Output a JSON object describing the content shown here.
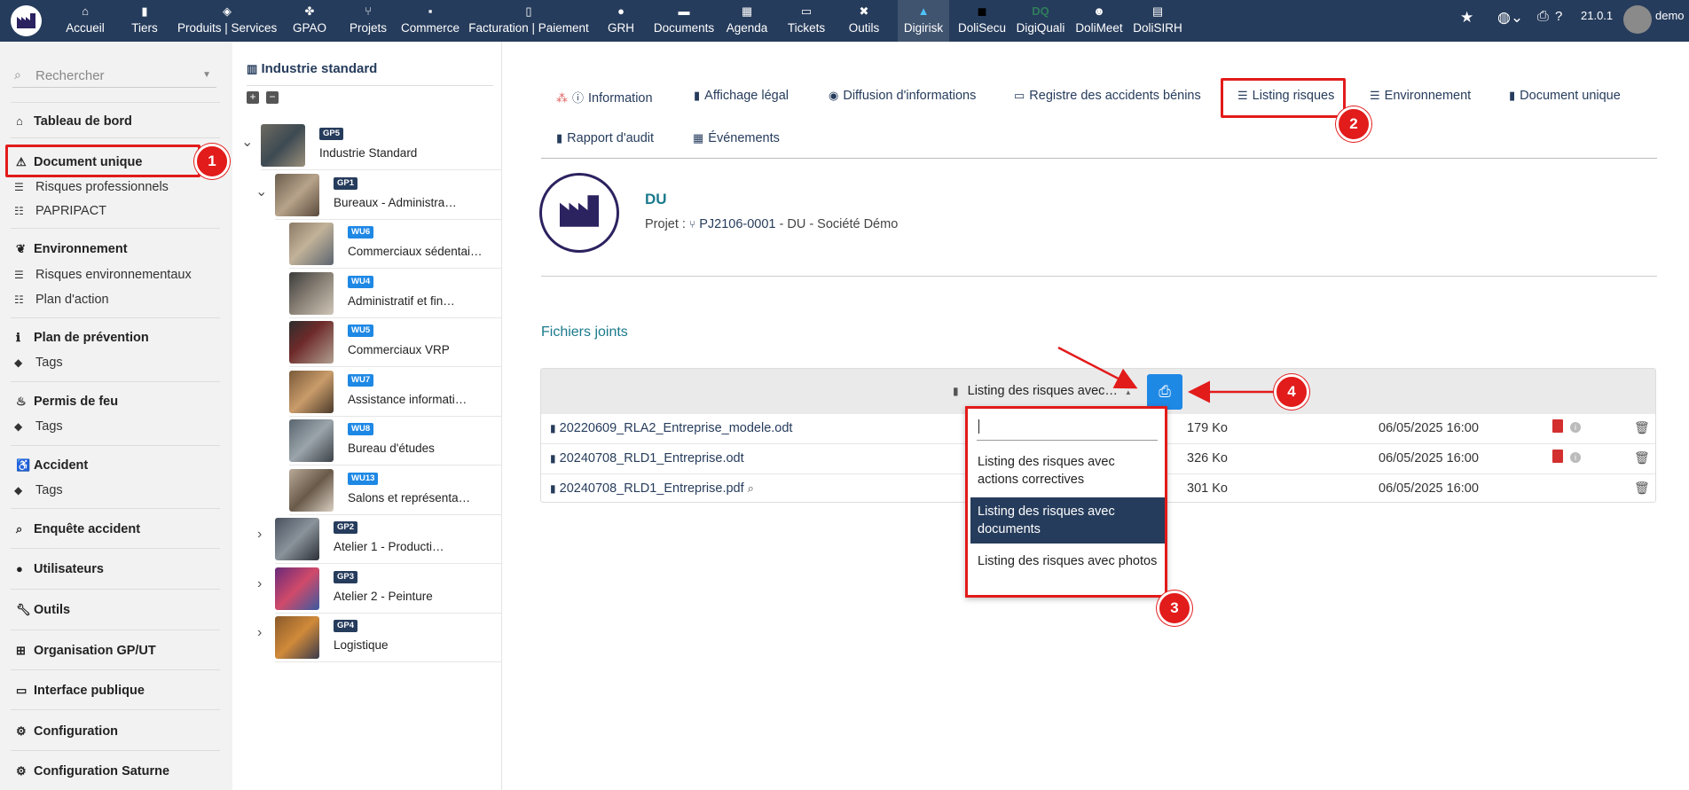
{
  "topbar": {
    "items": [
      {
        "label": "Accueil",
        "icon": "home-icon",
        "glyph": "⌂"
      },
      {
        "label": "Tiers",
        "icon": "building-icon",
        "glyph": "▮"
      },
      {
        "label": "Produits | Services",
        "icon": "cube-icon",
        "glyph": "◈"
      },
      {
        "label": "GPAO",
        "icon": "cubes-icon",
        "glyph": "✤"
      },
      {
        "label": "Projets",
        "icon": "project-icon",
        "glyph": "⑂"
      },
      {
        "label": "Commerce",
        "icon": "suitcase-icon",
        "glyph": "▪"
      },
      {
        "label": "Facturation | Paiement",
        "icon": "invoice-icon",
        "glyph": "▯"
      },
      {
        "label": "GRH",
        "icon": "user-icon",
        "glyph": "●"
      },
      {
        "label": "Documents",
        "icon": "folder-icon",
        "glyph": "▬"
      },
      {
        "label": "Agenda",
        "icon": "calendar-icon",
        "glyph": "▦"
      },
      {
        "label": "Tickets",
        "icon": "ticket-icon",
        "glyph": "▭"
      },
      {
        "label": "Outils",
        "icon": "tools-icon",
        "glyph": "✖"
      },
      {
        "label": "Digirisk",
        "icon": "digirisk-logo-icon",
        "glyph": "▲"
      },
      {
        "label": "DoliSecu",
        "icon": "lock-icon",
        "glyph": "■"
      },
      {
        "label": "DigiQuali",
        "icon": "digiquali-logo-icon",
        "glyph": "DQ"
      },
      {
        "label": "DoliMeet",
        "icon": "users-icon",
        "glyph": "☻"
      },
      {
        "label": "DoliSIRH",
        "icon": "id-card-icon",
        "glyph": "▤"
      }
    ],
    "version": "21.0.1",
    "user": "demo"
  },
  "search": {
    "placeholder": "Rechercher"
  },
  "leftmenu": {
    "tableau": "Tableau de bord",
    "document_unique": "Document unique",
    "risques_pro": "Risques professionnels",
    "papripact": "PAPRIPACT",
    "environnement": "Environnement",
    "risques_env": "Risques environnementaux",
    "plan_action": "Plan d'action",
    "plan_prevention": "Plan de prévention",
    "tags1": "Tags",
    "permis_feu": "Permis de feu",
    "tags2": "Tags",
    "accident": "Accident",
    "tags3": "Tags",
    "enquete": "Enquête accident",
    "utilisateurs": "Utilisateurs",
    "outils": "Outils",
    "organisation": "Organisation GP/UT",
    "interface": "Interface publique",
    "configuration": "Configuration",
    "config_saturne": "Configuration Saturne"
  },
  "tree": {
    "title": "Industrie standard",
    "nodes": [
      {
        "badge": "GP5",
        "label": "Industrie Standard",
        "color": "#263c5c"
      },
      {
        "badge": "GP1",
        "label": "Bureaux - Administra…",
        "color": "#263c5c"
      },
      {
        "badge": "WU6",
        "label": "Commerciaux sédentai…",
        "color": "#1e88e5"
      },
      {
        "badge": "WU4",
        "label": "Administratif et fin…",
        "color": "#1e88e5"
      },
      {
        "badge": "WU5",
        "label": "Commerciaux VRP",
        "color": "#1e88e5"
      },
      {
        "badge": "WU7",
        "label": "Assistance informati…",
        "color": "#1e88e5"
      },
      {
        "badge": "WU8",
        "label": "Bureau d'études",
        "color": "#1e88e5"
      },
      {
        "badge": "WU13",
        "label": "Salons et représenta…",
        "color": "#1e88e5"
      },
      {
        "badge": "GP2",
        "label": "Atelier 1 - Producti…",
        "color": "#263c5c"
      },
      {
        "badge": "GP3",
        "label": "Atelier 2 - Peinture",
        "color": "#263c5c"
      },
      {
        "badge": "GP4",
        "label": "Logistique",
        "color": "#263c5c"
      }
    ]
  },
  "tabs": {
    "information": "Information",
    "affichage": "Affichage légal",
    "diffusion": "Diffusion d'informations",
    "registre": "Registre des accidents bénins",
    "listing": "Listing risques",
    "environnement": "Environnement",
    "document_unique": "Document unique",
    "rapport": "Rapport d'audit",
    "evenements": "Événements"
  },
  "du": {
    "title": "DU",
    "project_prefix": "Projet :",
    "project_ref": "PJ2106-0001",
    "project_suffix": "- DU - Société Démo"
  },
  "files": {
    "title": "Fichiers joints",
    "model_select": "Listing des risques avec…",
    "rows": [
      {
        "name": "20220609_RLA2_Entreprise_modele.odt",
        "size": "179 Ko",
        "date": "06/05/2025 16:00",
        "pdf": true
      },
      {
        "name": "20240708_RLD1_Entreprise.odt",
        "size": "326 Ko",
        "date": "06/05/2025 16:00",
        "pdf": true
      },
      {
        "name": "20240708_RLD1_Entreprise.pdf",
        "size": "301 Ko",
        "date": "06/05/2025 16:00",
        "pdf": false
      }
    ]
  },
  "dropdown": {
    "search_value": "",
    "options": [
      "Listing des risques avec actions correctives",
      "Listing des risques avec documents",
      "Listing des risques avec photos"
    ],
    "selected_index": 1
  },
  "annotations": [
    "1",
    "2",
    "3",
    "4"
  ],
  "colors": {
    "navbar": "#263c5c",
    "accent": "#1e88e5",
    "annotation": "#e21b1b",
    "teal": "#1a7a8c"
  }
}
